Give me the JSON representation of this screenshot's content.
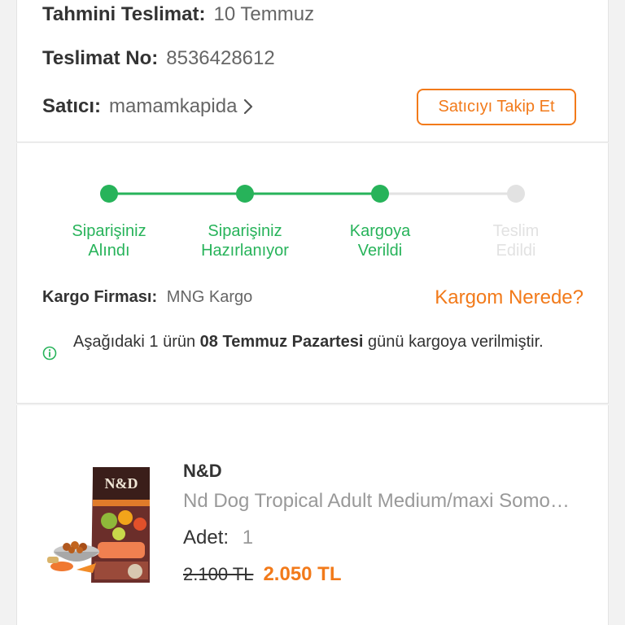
{
  "info": {
    "delivery_label": "Tahmini Teslimat:",
    "delivery_value": "10 Temmuz",
    "tracking_label": "Teslimat No:",
    "tracking_value": "8536428612",
    "seller_label": "Satıcı:",
    "seller_value": "mamamkapida",
    "follow_button": "Satıcıyı Takip Et"
  },
  "tracking": {
    "steps": [
      {
        "label": "Siparişiniz\nAlındı",
        "done": true
      },
      {
        "label": "Siparişiniz\nHazırlanıyor",
        "done": true
      },
      {
        "label": "Kargoya\nVerildi",
        "done": true
      },
      {
        "label": "Teslim\nEdildi",
        "done": false
      }
    ],
    "cargo_label": "Kargo Firması:",
    "cargo_value": "MNG Kargo",
    "where_link": "Kargom Nerede?",
    "notice_prefix": "Aşağıdaki 1 ürün ",
    "notice_bold": "08 Temmuz Pazartesi",
    "notice_suffix": " günü kargoya verilmiştir.",
    "notice_icon": "info-circle-icon"
  },
  "product": {
    "brand": "N&D",
    "name": "Nd Dog Tropical Adult Medium/maxi Somon Ve Tropikal Meyveli Köpek Maması",
    "qty_label": "Adet:",
    "qty_value": "1",
    "old_price": "2.100 TL",
    "new_price": "2.050 TL"
  },
  "colors": {
    "accent": "#f27a1a",
    "success": "#27b35a",
    "inactive": "#e2e2e2"
  }
}
